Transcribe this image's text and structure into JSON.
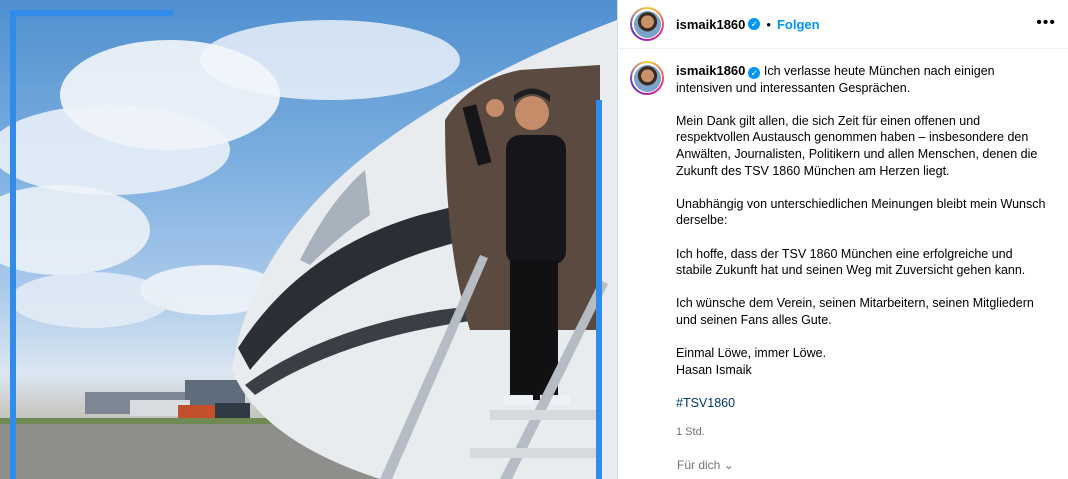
{
  "post": {
    "username": "ismaik1860",
    "follow_label": "Folgen",
    "separator": "•",
    "more_label": "•••",
    "caption_first": "Ich verlasse heute München nach einigen intensiven und interessanten Gesprächen.",
    "caption_paragraphs": [
      "Mein Dank gilt allen, die sich Zeit für einen offenen und respektvollen Austausch genommen haben – insbesondere den Anwälten, Journalisten, Politikern und allen Menschen, denen die Zukunft des TSV 1860 München am Herzen liegt.",
      "Unabhängig von unterschiedlichen Meinungen bleibt mein Wunsch derselbe:",
      "Ich hoffe, dass der TSV 1860 München eine erfolgreiche und stabile Zukunft hat und seinen Weg mit Zuversicht gehen kann.",
      "Ich wünsche dem Verein, seinen Mitarbeitern, seinen Mitgliedern und seinen Fans alles Gute."
    ],
    "closing_line1": "Einmal Löwe, immer Löwe.",
    "closing_line2": "Hasan Ismaik",
    "hashtag": "#TSV1860",
    "timestamp": "1 Std.",
    "for_you_label": "Für dich",
    "accent_color": "#0095f6"
  }
}
